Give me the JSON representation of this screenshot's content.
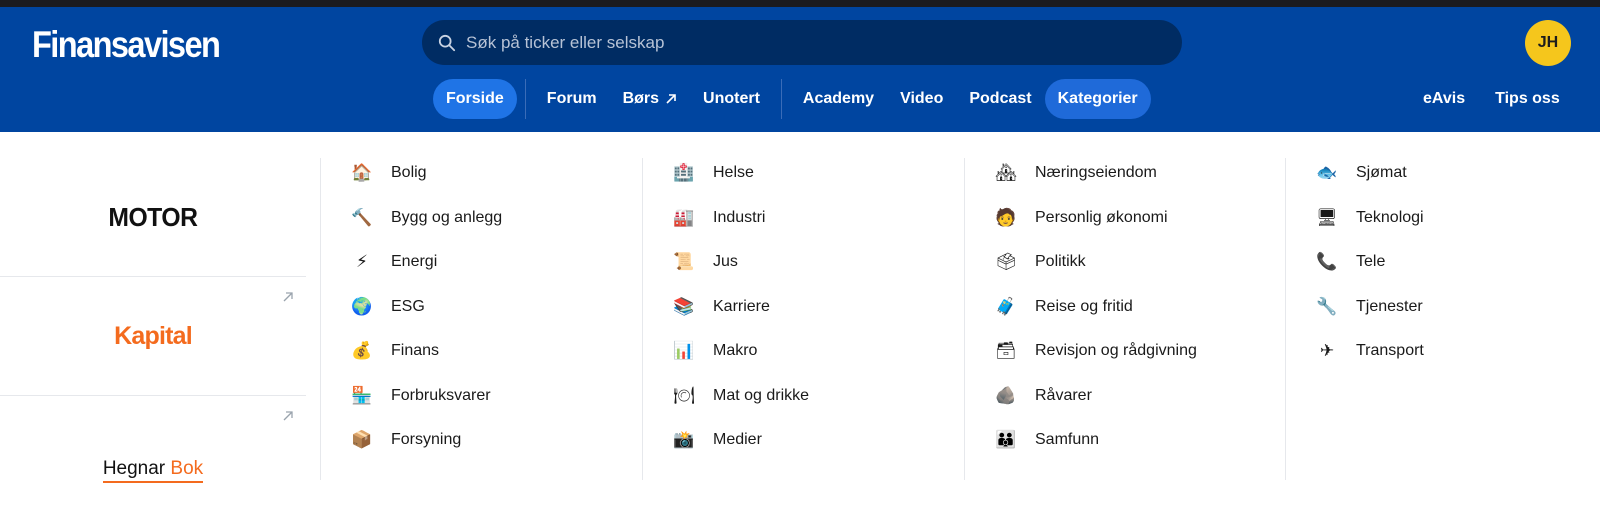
{
  "header": {
    "logo": "Finansavisen",
    "search_placeholder": "Søk på ticker eller selskap",
    "avatar_initials": "JH",
    "nav": [
      {
        "label": "Forside"
      },
      {
        "label": "Forum"
      },
      {
        "label": "Børs"
      },
      {
        "label": "Unotert"
      },
      {
        "label": "Academy"
      },
      {
        "label": "Video"
      },
      {
        "label": "Podcast"
      },
      {
        "label": "Kategorier"
      }
    ],
    "right_links": [
      {
        "label": "eAvis"
      },
      {
        "label": "Tips oss"
      }
    ]
  },
  "brands": {
    "motor": "MOTOR",
    "kapital": "Kapital",
    "hegnar_first": "Hegnar",
    "hegnar_second": "Bok"
  },
  "categories": {
    "col1": [
      {
        "label": "Bolig",
        "icon": "house-icon",
        "glyph": "🏠"
      },
      {
        "label": "Bygg og anlegg",
        "icon": "hammer-icon",
        "glyph": "🔨"
      },
      {
        "label": "Energi",
        "icon": "lightning-icon",
        "glyph": "⚡"
      },
      {
        "label": "ESG",
        "icon": "globe-icon",
        "glyph": "🌍"
      },
      {
        "label": "Finans",
        "icon": "money-bag-icon",
        "glyph": "💰"
      },
      {
        "label": "Forbruksvarer",
        "icon": "store-icon",
        "glyph": "🏪"
      },
      {
        "label": "Forsyning",
        "icon": "package-icon",
        "glyph": "📦"
      }
    ],
    "col2": [
      {
        "label": "Helse",
        "icon": "hospital-icon",
        "glyph": "🏥"
      },
      {
        "label": "Industri",
        "icon": "factory-icon",
        "glyph": "🏭"
      },
      {
        "label": "Jus",
        "icon": "scroll-icon",
        "glyph": "📜"
      },
      {
        "label": "Karriere",
        "icon": "books-icon",
        "glyph": "📚"
      },
      {
        "label": "Makro",
        "icon": "bar-chart-icon",
        "glyph": "📊"
      },
      {
        "label": "Mat og drikke",
        "icon": "plate-icon",
        "glyph": "🍽"
      },
      {
        "label": "Medier",
        "icon": "camera-icon",
        "glyph": "📸"
      }
    ],
    "col3": [
      {
        "label": "Næringseiendom",
        "icon": "houses-icon",
        "glyph": "🏘"
      },
      {
        "label": "Personlig økonomi",
        "icon": "office-worker-icon",
        "glyph": "🧑"
      },
      {
        "label": "Politikk",
        "icon": "ballot-box-icon",
        "glyph": "🗳"
      },
      {
        "label": "Reise og fritid",
        "icon": "suitcase-icon",
        "glyph": "🧳"
      },
      {
        "label": "Revisjon og rådgivning",
        "icon": "file-box-icon",
        "glyph": "🗃"
      },
      {
        "label": "Råvarer",
        "icon": "rock-icon",
        "glyph": "🪨"
      },
      {
        "label": "Samfunn",
        "icon": "people-icon",
        "glyph": "👪"
      }
    ],
    "col4": [
      {
        "label": "Sjømat",
        "icon": "fish-icon",
        "glyph": "🐟"
      },
      {
        "label": "Teknologi",
        "icon": "computer-icon",
        "glyph": "🖥"
      },
      {
        "label": "Tele",
        "icon": "phone-icon",
        "glyph": "📞"
      },
      {
        "label": "Tjenester",
        "icon": "wrench-icon",
        "glyph": "🔧"
      },
      {
        "label": "Transport",
        "icon": "airplane-icon",
        "glyph": "✈"
      }
    ]
  },
  "colors": {
    "header_bg": "#0045a0",
    "search_bg": "#002c63",
    "active_pill": "#1f74e6",
    "avatar_bg": "#f5c61c",
    "brand_orange": "#f46b1e"
  }
}
